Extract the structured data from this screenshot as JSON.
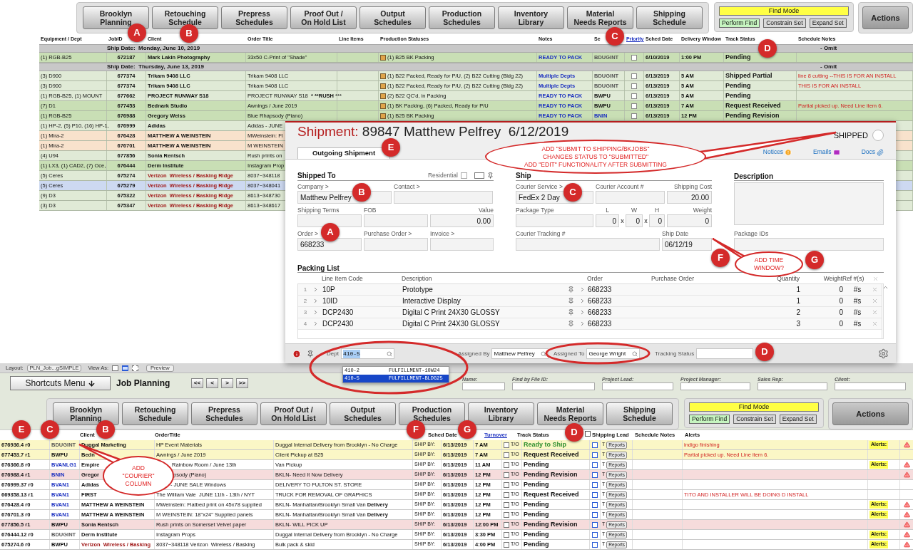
{
  "top_panel": {
    "nav_buttons": [
      "Brooklyn\nPlanning",
      "Retouching\nSchedule",
      "Prepress\nSchedules",
      "Proof Out /\nOn Hold List",
      "Output\nSchedules",
      "Production\nSchedules",
      "Inventory\nLibrary",
      "Material\nNeeds Reports",
      "Shipping\nSchedule"
    ],
    "find": {
      "mode": "Find Mode",
      "perform": "Perform Find",
      "constrain": "Constrain Set",
      "expand": "Expand Set"
    },
    "actions": "Actions",
    "columns": [
      "Equipment / Dept",
      "JobID",
      "Client",
      "Order Title",
      "Line Items",
      "Production Statuses",
      "Notes",
      "Se",
      "Priority",
      "Sched Date",
      "Delivery Window",
      "Track Status",
      "Schedule Notes"
    ],
    "groups": [
      {
        "ship_date": "Ship Date:  Monday, June 10, 2019",
        "omit": "- Omit",
        "rows": [
          {
            "equipment": "(1) RGB-B25",
            "job_id": "672187",
            "client": {
              "text": "Mark Lakin Photography",
              "color": "#111111"
            },
            "order_title": "33x50 C-Print of \"Shade\"",
            "status": "(1) B25 BK Packing",
            "notes": {
              "text": "READY TO PACK",
              "color": "#1a2fc0"
            },
            "service": {
              "text": "BDUGINT",
              "color": "#555555"
            },
            "priority": false,
            "sched_date": "6/10/2019",
            "delivery": "1:00 PM",
            "track": "Pending",
            "color": "#c9dfb5",
            "selected": false
          }
        ]
      },
      {
        "ship_date": "Ship Date:  Thursday, June 13, 2019",
        "omit": "- Omit",
        "rows": [
          {
            "equipment": "(3) D900",
            "job_id": "677374",
            "client": {
              "text": "Trikam 9408 LLC",
              "color": "#111111"
            },
            "order_title": "Trikam 9408 LLC",
            "status": "(1) B22 Packed, Ready for P/U, (2) B22 Cutting (Bldg 22)",
            "notes": {
              "text": "Multiple Depts",
              "color": "#1a2fc0"
            },
            "service": {
              "text": "BDUGINT",
              "color": "#555555"
            },
            "priority": false,
            "sched_date": "6/13/2019",
            "delivery": "5 AM",
            "track": "Shipped Partial",
            "schedule_notes": "line 8 cutting --THIS IS FOR AN INSTALL",
            "color": "#e0ead6",
            "selected": false
          },
          {
            "equipment": "(3) D900",
            "job_id": "677374",
            "client": {
              "text": "Trikam 9408 LLC",
              "color": "#111111"
            },
            "order_title": "Trikam 9408 LLC",
            "status": "(1) B22 Packed, Ready for P/U, (2) B22 Cutting (Bldg 22)",
            "notes": {
              "text": "Multiple Depts",
              "color": "#1a2fc0"
            },
            "service": {
              "text": "BDUGINT",
              "color": "#555555"
            },
            "priority": false,
            "sched_date": "6/13/2019",
            "delivery": "5 AM",
            "track": "Pending",
            "schedule_notes": "THIS IS FOR AN INSTALL",
            "color": "#e0ead6",
            "selected": false
          },
          {
            "equipment": "(1) RGB-B25, (1) MOUNT",
            "job_id": "677662",
            "client": {
              "text": "PROJECT RUNWAY S18",
              "color": "#111111"
            },
            "order_title": "PROJECT RUNWAY S18  *** **RUSH** ***",
            "status": "(2) B22 QC'd, in Packing",
            "notes": {
              "text": "READY TO PACK",
              "color": "#1a2fc0"
            },
            "service": {
              "text": "BWPU",
              "color": "#111111"
            },
            "priority": false,
            "sched_date": "6/13/2019",
            "delivery": "5 AM",
            "track": "Pending",
            "color": "#e0ead6",
            "selected": false
          },
          {
            "equipment": "(7) D1",
            "job_id": "677453",
            "client": {
              "text": "Bednark Studio",
              "color": "#111111"
            },
            "order_title": "Awnings / June 2019",
            "status": "(1) BK Packing, (6) Packed, Ready for P/U",
            "notes": {
              "text": "READY TO PACK",
              "color": "#1a2fc0"
            },
            "service": {
              "text": "BWPU",
              "color": "#111111"
            },
            "priority": false,
            "sched_date": "6/13/2019",
            "delivery": "7 AM",
            "track": "Request Received",
            "schedule_notes": "Partial picked up. Need Line item 6.",
            "color": "#c9dfb5",
            "selected": false
          },
          {
            "equipment": "(1) RGB-B25",
            "job_id": "676988",
            "client": {
              "text": "Gregory Weiss",
              "color": "#111111"
            },
            "order_title": "Blue Rhapsody (Piano)",
            "status": "(1) B25 BK Packing",
            "notes": {
              "text": "READY TO PACK",
              "color": "#1a2fc0"
            },
            "service": {
              "text": "BNIN",
              "color": "#1a2fc0"
            },
            "priority": false,
            "sched_date": "6/13/2019",
            "delivery": "12 PM",
            "track": "Pending Revision",
            "color": "#c9dfb5",
            "selected": false
          },
          {
            "equipment": "(1) HP-2, (5) P10, (16) HP-1,",
            "job_id": "676999",
            "client": {
              "text": "Adidas",
              "color": "#111111"
            },
            "order_title": "Adidas - JUNE",
            "color": "#e0ead6",
            "selected": false
          },
          {
            "equipment": "(1) Mira-2",
            "job_id": "676428",
            "client": {
              "text": "MATTHEW A WEINSTEIN",
              "color": "#111111"
            },
            "order_title": "MWeinstein: Fl",
            "color": "#f8e2cc",
            "selected": false
          },
          {
            "equipment": "(1) Mira-2",
            "job_id": "676701",
            "client": {
              "text": "MATTHEW A WEINSTEIN",
              "color": "#111111"
            },
            "order_title": "M WEINSTEIN",
            "color": "#f8e2cc",
            "selected": false
          },
          {
            "equipment": "(4) U94",
            "job_id": "677856",
            "client": {
              "text": "Sonia Rentsch",
              "color": "#111111"
            },
            "order_title": "Rush prints on",
            "color": "#e0ead6",
            "selected": false
          },
          {
            "equipment": "(1) LX3, (1) CAD2, (7) Oce,",
            "job_id": "676444",
            "client": {
              "text": "Derm Institute",
              "color": "#111111"
            },
            "order_title": "Instagram Prop",
            "color": "#c9dfb5",
            "selected": false
          },
          {
            "equipment": "(5) Ceres",
            "job_id": "675274",
            "client": {
              "text": "Verizon  Wireless / Basking Ridge",
              "color": "#a01818"
            },
            "order_title": "8037~348118",
            "color": "#e0ead6",
            "selected": false
          },
          {
            "equipment": "(5) Ceres",
            "job_id": "675279",
            "client": {
              "text": "Verizon  Wireless / Basking Ridge",
              "color": "#a01818"
            },
            "order_title": "8037~348041",
            "selected": true
          },
          {
            "equipment": "(9) D3",
            "job_id": "675322",
            "client": {
              "text": "Verizon  Wireless / Basking Ridge",
              "color": "#a01818"
            },
            "order_title": "8613~348730",
            "color": "#e0ead6",
            "selected": false
          },
          {
            "equipment": "(3) D3",
            "job_id": "675347",
            "client": {
              "text": "Verizon  Wireless / Basking Ridge",
              "color": "#a01818"
            },
            "order_title": "8613~348617",
            "color": "#e0ead6",
            "selected": false
          }
        ]
      }
    ]
  },
  "shipment": {
    "label": "Shipment:",
    "title": "89847 Matthew Pelfrey  6/12/2019",
    "status": {
      "label": "SHIPPED",
      "on": false
    },
    "tabs": [
      {
        "label": "Outgoing Shipment",
        "selected": true
      }
    ],
    "links": [
      {
        "label": "Notices",
        "kind": "notice"
      },
      {
        "label": "Emails",
        "kind": "email"
      },
      {
        "label": "Docs",
        "kind": "docs"
      }
    ],
    "shipped_to": {
      "heading": "Shipped To",
      "residential": {
        "label": "Residential",
        "checked": false
      },
      "rows": [
        [
          {
            "label": "Company >",
            "value": "Matthew Pelfrey",
            "kind": "text"
          },
          {
            "label": "Contact >",
            "kind": "text"
          }
        ],
        [
          {
            "label": "Shipping Terms",
            "kind": "text"
          },
          {
            "label": "FOB",
            "kind": "text"
          },
          {
            "label": "Value",
            "value": "0.00",
            "kind": "number"
          }
        ],
        [
          {
            "label": "Order >",
            "value": "668233",
            "kind": "text"
          },
          {
            "label": "Purchase Order >",
            "kind": "text"
          },
          {
            "label": "Invoice >",
            "kind": "text"
          }
        ]
      ]
    },
    "shipping": {
      "heading": "Ship",
      "rows": [
        [
          {
            "label": "Courier Service >",
            "value": "FedEx 2 Day",
            "kind": "text"
          },
          {
            "label": "Courier Account #",
            "kind": "text"
          },
          {
            "label": "Shipping Cost",
            "value": "20.00",
            "kind": "number"
          }
        ],
        [
          {
            "label": "Package Type",
            "kind": "text"
          },
          {
            "kind": "dims",
            "parts": [
              {
                "label": "L",
                "value": "0"
              },
              {
                "label": "W",
                "value": "0",
                "separator": "x"
              },
              {
                "label": "H",
                "value": "0",
                "separator": "x"
              }
            ]
          },
          {
            "label": "Weight",
            "value": "0",
            "kind": "number"
          }
        ],
        [
          {
            "label": "Courier Tracking #",
            "kind": "text"
          },
          {
            "label": "Ship Date",
            "value": "06/12/19",
            "kind": "text"
          }
        ]
      ]
    },
    "description": {
      "label": "Description"
    },
    "package_ids": {
      "label": "Package IDs"
    },
    "packing_list": {
      "heading": "Packing List",
      "columns": [
        "Line Item Code",
        "Description",
        "Order",
        "Purchase Order",
        "Quantity",
        "Weight",
        "Ref #(s)"
      ],
      "rows": [
        {
          "num": "1",
          "code": "10P",
          "description": "Prototype",
          "order": "668233",
          "quantity": "1",
          "weight": "0",
          "ref": "#s"
        },
        {
          "num": "2",
          "code": "10ID",
          "description": "Interactive Display",
          "order": "668233",
          "quantity": "1",
          "weight": "0",
          "ref": "#s"
        },
        {
          "num": "3",
          "code": "DCP2430",
          "description": "Digital C Print 24X30 GLOSSY",
          "order": "668233",
          "quantity": "2",
          "weight": "0",
          "ref": "#s"
        },
        {
          "num": "4",
          "code": "DCP2430",
          "description": "Digital C Print 24X30 GLOSSY",
          "order": "668233",
          "quantity": "3",
          "weight": "0",
          "ref": "#s"
        }
      ]
    },
    "footer": {
      "dept": {
        "label": "Dept",
        "value": "410-5"
      },
      "assigned_by": {
        "label": "Assigned By",
        "value": "Matthew Pelfrey"
      },
      "assigned_to": {
        "label": "Assigned To",
        "value": "George Wright"
      },
      "tracking_status": {
        "label": "Tracking Status"
      }
    }
  },
  "dropdown": {
    "options": [
      {
        "code": "410-2",
        "name": "FULFILLMENT-10W24",
        "selected": false
      },
      {
        "code": "410-5",
        "name": "FULFILLMENT-BLDG25",
        "selected": true
      }
    ]
  },
  "job_planning": {
    "toolbar": {
      "layout_label": "Layout:",
      "layout_value": "PLN_Job...gSIMPLE",
      "view_as": "View As:",
      "view_modes": [
        {
          "kind": "form",
          "selected": false
        },
        {
          "kind": "list",
          "selected": true
        },
        {
          "kind": "table",
          "selected": false
        }
      ],
      "preview": "Preview"
    },
    "shortcuts": "Shortcuts Menu",
    "title": "Job Planning",
    "pager": [
      "<<",
      "<",
      ">",
      ">>"
    ],
    "search_fields": [
      "Name:",
      "Find by File ID:",
      "Project Lead:",
      "Project Manager:",
      "Sales Rep:",
      "Client:"
    ],
    "nav_buttons": [
      "Brooklyn\nPlanning",
      "Retouching\nSchedule",
      "Prepress\nSchedules",
      "Proof Out /\nOn Hold List",
      "Output\nSchedules",
      "Production\nSchedules",
      "Inventory\nLibrary",
      "Material\nNeeds Reports",
      "Shipping\nSchedule"
    ],
    "find": {
      "mode": "Find Mode",
      "perform": "Perform Find",
      "constrain": "Constrain Set",
      "expand": "Expand Set"
    },
    "actions": "Actions",
    "header_checked": false,
    "columns": [
      "Client",
      "OrderTitle",
      "Sched Date",
      "Turnover",
      "Track Status",
      "Shipping Lead",
      "Schedule Notes",
      "Alerts"
    ],
    "rows": [
      {
        "job": "676936.4 r0",
        "courier": {
          "text": "BDUGINT",
          "color": "#555555"
        },
        "client": "Duggal Marketing",
        "order_title": "HP Event Materials",
        "delivery": "Duggal Internal Delivery from Brooklyn - No Charge",
        "ship_by": "SHIP BY:",
        "date": "6/13/2019",
        "time": "7 AM",
        "turnover": "T/O",
        "turnover_checked": false,
        "track": {
          "text": "Ready to Ship",
          "color": "#2f8f2f"
        },
        "flag": "T",
        "flag_checked": false,
        "reports": "Reports",
        "schedule_notes": "indigo finishing",
        "alerts": "Alerts:",
        "warning": true,
        "color": "#fbf7c6"
      },
      {
        "job": "677453.7 r1",
        "courier": {
          "text": "BWPU",
          "color": "#111111"
        },
        "client": "Bedn",
        "order_title": "Awnings / June 2019",
        "delivery": "Client Pickup at B25",
        "ship_by": "SHIP BY:",
        "date": "6/13/2019",
        "time": "7 AM",
        "turnover": "T/O",
        "turnover_checked": false,
        "track": {
          "text": "Request Received",
          "color": "#111111"
        },
        "flag": "T",
        "flag_checked": false,
        "reports": "Reports",
        "schedule_notes": "Partial picked up. Need Line item 6.",
        "warning": false,
        "color": "#fbf7c6"
      },
      {
        "job": "676366.8 r0",
        "courier": {
          "text": "BVANLG1",
          "color": "#1a2fc0"
        },
        "client": "Empire",
        "order_title": "Rainbow Room / June 13th",
        "delivery": "Van Pickup",
        "ship_by": "SHIP BY:",
        "date": "6/13/2019",
        "time": "11 AM",
        "turnover": "T/O",
        "turnover_checked": false,
        "track": {
          "text": "Pending",
          "color": "#111111"
        },
        "flag": "T",
        "flag_checked": false,
        "reports": "Reports",
        "alerts": "Alerts:",
        "warning": true,
        "color": "#ffffff"
      },
      {
        "job": "676988.4 r1",
        "courier": {
          "text": "BNIN",
          "color": "#1a2fc0"
        },
        "client": "Gregor",
        "order_title": "psody (Piano)",
        "delivery": "BKLN- Need It Now Delivery",
        "ship_by": "SHIP BY:",
        "date": "6/13/2019",
        "time": "12 PM",
        "turnover": "T/O",
        "turnover_checked": false,
        "track": {
          "text": "Pending Revision",
          "color": "#111111"
        },
        "flag": "T",
        "flag_checked": false,
        "reports": "Reports",
        "warning": true,
        "color": "#f6dcdc"
      },
      {
        "job": "676999.37 r0",
        "courier": {
          "text": "BVAN1",
          "color": "#1a2fc0"
        },
        "client": "Adidas",
        "order_title": "- JUNE SALE Windows",
        "delivery": "DELIVERY TO FULTON ST. STORE",
        "ship_by": "SHIP BY:",
        "date": "6/13/2019",
        "time": "12 PM",
        "turnover": "T/O",
        "turnover_checked": false,
        "track": {
          "text": "Pending",
          "color": "#111111"
        },
        "flag": "T",
        "flag_checked": false,
        "reports": "Reports",
        "warning": false,
        "color": "#ffffff"
      },
      {
        "job": "669358.13 r1",
        "courier": {
          "text": "BVAN1",
          "color": "#1a2fc0"
        },
        "client": "FIRST",
        "order_title": "The William Vale  JUNE 11th - 13th / NYT",
        "delivery": "TRUCK FOR REMOVAL OF GRAPHICS",
        "ship_by": "SHIP BY:",
        "date": "6/13/2019",
        "time": "12 PM",
        "turnover": "T/O",
        "turnover_checked": false,
        "track": {
          "text": "Request Received",
          "color": "#111111"
        },
        "flag": "T",
        "flag_checked": false,
        "reports": "Reports",
        "schedule_notes": "TITO AND INSTALLER WILL BE DOING D INSTALL",
        "warning": false,
        "color": "#ffffff"
      },
      {
        "job": "676428.4 r0",
        "courier": {
          "text": "BVAN1",
          "color": "#1a2fc0"
        },
        "client": "MATTHEW A WEINSTEIN",
        "order_title": "MWeinstein: Flatbed print on 45x78 supplied",
        "delivery": "BKLN- Manhattan/Brooklyn Small Van **Delivery**",
        "ship_by": "SHIP BY:",
        "date": "6/13/2019",
        "time": "12 PM",
        "turnover": "T/O",
        "turnover_checked": false,
        "track": {
          "text": "Pending",
          "color": "#111111"
        },
        "flag": "T",
        "flag_checked": false,
        "reports": "Reports",
        "alerts": "Alerts:",
        "warning": true,
        "color": "#ffffff"
      },
      {
        "job": "676701.3 r0",
        "courier": {
          "text": "BVAN1",
          "color": "#1a2fc0"
        },
        "client": "MATTHEW A WEINSTEIN",
        "order_title": "M WEINSTEIN: 18\"x24\" Supplied panels",
        "delivery": "BKLN- Manhattan/Brooklyn Small Van **Delivery**",
        "ship_by": "SHIP BY:",
        "date": "6/13/2019",
        "time": "12 PM",
        "turnover": "T/O",
        "turnover_checked": false,
        "track": {
          "text": "Pending",
          "color": "#111111"
        },
        "flag": "T",
        "flag_checked": false,
        "reports": "Reports",
        "alerts": "Alerts:",
        "warning": true,
        "color": "#ffffff"
      },
      {
        "job": "677856.5 r1",
        "courier": {
          "text": "BWPU",
          "color": "#111111"
        },
        "client": "Sonia Rentsch",
        "order_title": "Rush prints on Somerset Velvet paper",
        "delivery": "BKLN- WILL PICK UP",
        "ship_by": "SHIP BY:",
        "date": "6/13/2019",
        "time": "12:00 PM",
        "turnover": "T/O",
        "turnover_checked": false,
        "track": {
          "text": "Pending Revision",
          "color": "#111111"
        },
        "flag": "T",
        "flag_checked": false,
        "reports": "Reports",
        "warning": true,
        "color": "#f6dcdc"
      },
      {
        "job": "676444.12 r0",
        "courier": {
          "text": "BDUGINT",
          "color": "#555555"
        },
        "client": "Derm Institute",
        "order_title": "Instagram Props",
        "delivery": "Duggal Internal Delivery from Brooklyn - No Charge",
        "ship_by": "SHIP BY:",
        "date": "6/13/2019",
        "time": "3:30 PM",
        "turnover": "T/O",
        "turnover_checked": false,
        "track": {
          "text": "Pending",
          "color": "#111111"
        },
        "flag": "T",
        "flag_checked": false,
        "reports": "Reports",
        "alerts": "Alerts:",
        "warning": true,
        "color": "#ffffff"
      },
      {
        "job": "675274.6 r0",
        "courier": {
          "text": "BWPU",
          "color": "#111111"
        },
        "client": {
          "text": "Verizon  Wireless / Basking",
          "color": "#a01818"
        },
        "order_title": "8037~348118 Verizon  Wireless / Basking",
        "delivery": "Bulk pack & skid",
        "ship_by": "SHIP BY:",
        "date": "6/13/2019",
        "time": "4:00 PM",
        "turnover": "T/O",
        "turnover_checked": false,
        "track": {
          "text": "Pending",
          "color": "#111111"
        },
        "flag": "T",
        "flag_checked": false,
        "reports": "Reports",
        "alerts": "Alerts:",
        "warning": true,
        "color": "#ffffff"
      }
    ]
  },
  "callouts": [
    {
      "text": "ADD \"SUBMIT TO SHIPPING/BKJOBS\"\nCHANGES STATUS TO \"SUBMITTED\"\nADD \"EDIT\" FUNCTIONALITY AFTER SUBMITTING"
    },
    {
      "text": "ADD TIME\nWINDOW?"
    },
    {
      "text": "ADD\n\"COURIER\"\nCOLUMN"
    }
  ],
  "markers": [
    {
      "letter": "A"
    },
    {
      "letter": "B"
    },
    {
      "letter": "C"
    },
    {
      "letter": "D"
    },
    {
      "letter": "E"
    },
    {
      "letter": "B"
    },
    {
      "letter": "C"
    },
    {
      "letter": "A"
    },
    {
      "letter": "F"
    },
    {
      "letter": "G"
    },
    {
      "letter": "D"
    },
    {
      "letter": "E"
    },
    {
      "letter": "C"
    },
    {
      "letter": "B"
    },
    {
      "letter": "F"
    },
    {
      "letter": "G"
    },
    {
      "letter": "D"
    }
  ]
}
